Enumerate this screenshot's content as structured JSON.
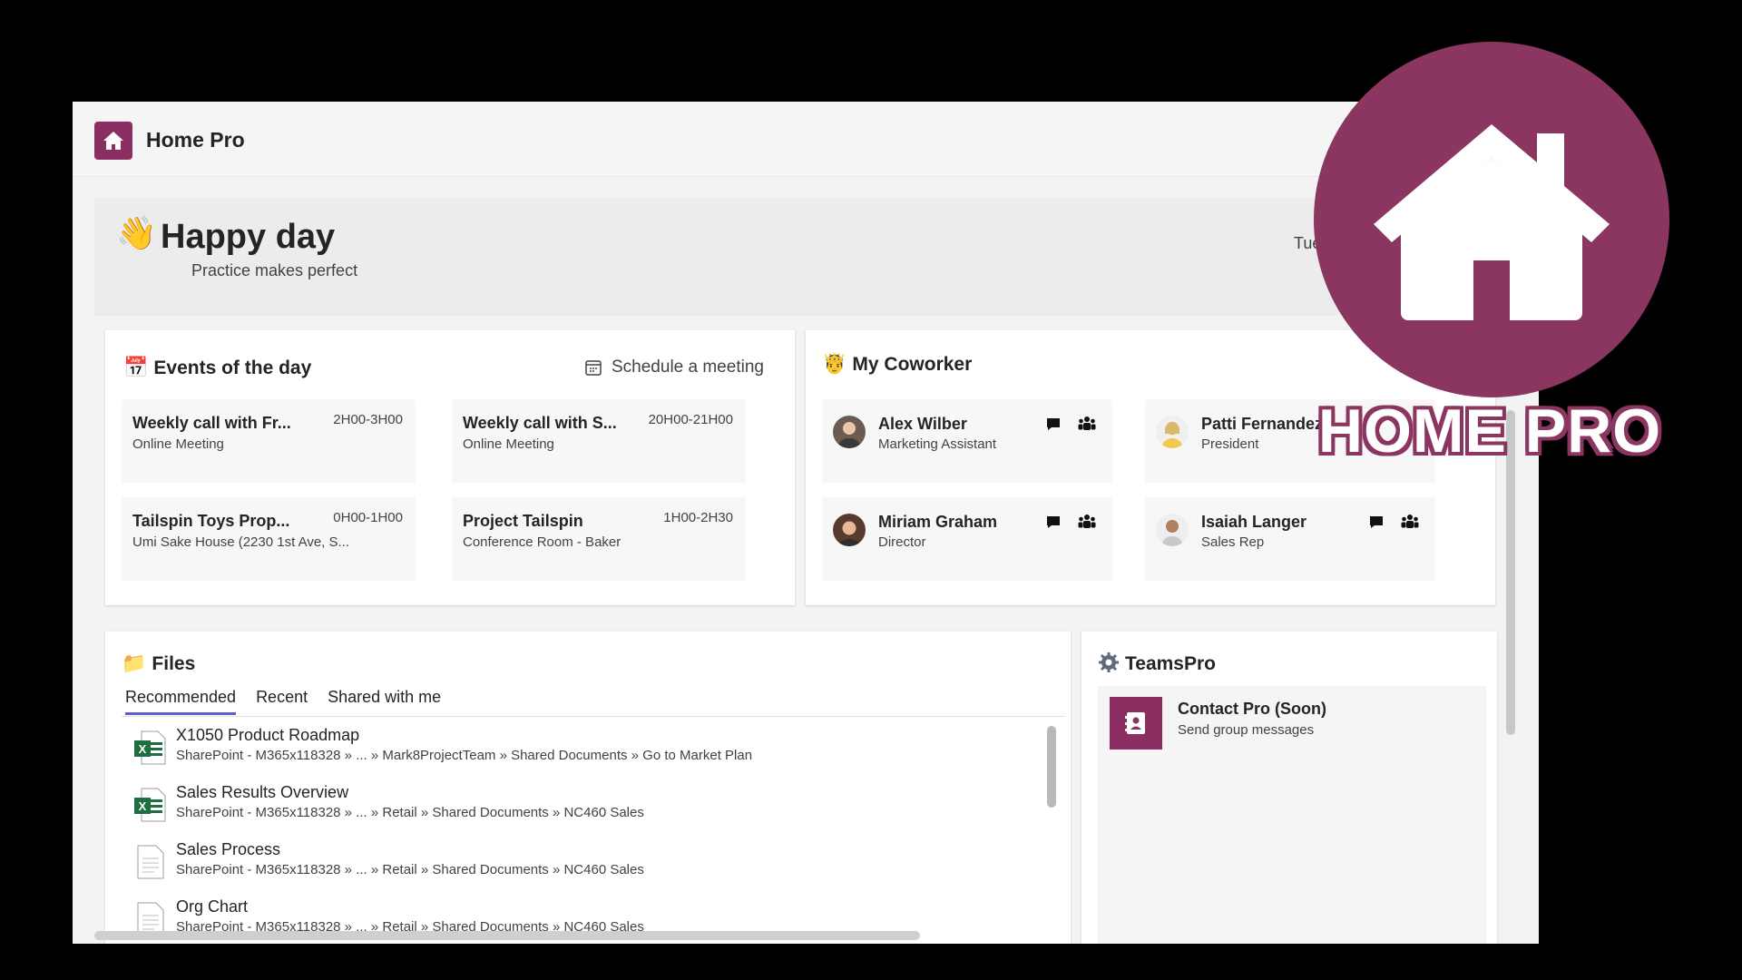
{
  "app": {
    "title": "Home Pro",
    "accent": "#8b2e61"
  },
  "hero": {
    "emoji": "👋",
    "greeting": "Happy day",
    "motto": "Practice makes perfect",
    "date": "Tuesd"
  },
  "events": {
    "emoji": "📅",
    "title": "Events of the day",
    "schedule_label": "Schedule a meeting",
    "items": [
      {
        "title": "Weekly call with Fr...",
        "time": "2H00-3H00",
        "location": "Online Meeting"
      },
      {
        "title": "Weekly call with S...",
        "time": "20H00-21H00",
        "location": "Online Meeting"
      },
      {
        "title": "Tailspin Toys Prop...",
        "time": "0H00-1H00",
        "location": "Umi Sake House (2230 1st Ave, S..."
      },
      {
        "title": "Project Tailspin",
        "time": "1H00-2H30",
        "location": "Conference Room - Baker"
      }
    ]
  },
  "coworkers": {
    "emoji": "🤴",
    "title": "My Coworker",
    "items": [
      {
        "name": "Alex Wilber",
        "role": "Marketing Assistant",
        "color": "#6b5b50"
      },
      {
        "name": "Patti Fernandez",
        "role": "President",
        "color": "#d8b96a"
      },
      {
        "name": "Miriam Graham",
        "role": "Director",
        "color": "#5a3a2e"
      },
      {
        "name": "Isaiah Langer",
        "role": "Sales Rep",
        "color": "#b08060"
      }
    ]
  },
  "files": {
    "emoji": "📁",
    "title": "Files",
    "tabs": [
      "Recommended",
      "Recent",
      "Shared with me"
    ],
    "items": [
      {
        "name": "X1050 Product Roadmap",
        "path": "SharePoint - M365x118328 » ... » Mark8ProjectTeam » Shared Documents » Go to Market Plan",
        "icon": "excel-icon"
      },
      {
        "name": "Sales Results Overview",
        "path": "SharePoint - M365x118328 » ... » Retail » Shared Documents » NC460 Sales",
        "icon": "excel-icon"
      },
      {
        "name": "Sales Process",
        "path": "SharePoint - M365x118328 » ... » Retail » Shared Documents » NC460 Sales",
        "icon": "document-icon"
      },
      {
        "name": "Org Chart",
        "path": "SharePoint - M365x118328 » ... » Retail » Shared Documents » NC460 Sales",
        "icon": "document-icon"
      }
    ]
  },
  "teams": {
    "title": "TeamsPro",
    "item": {
      "name": "Contact Pro (Soon)",
      "sub": "Send group messages"
    }
  },
  "badge": {
    "text": "HOME PRO",
    "color": "#8b3561"
  }
}
